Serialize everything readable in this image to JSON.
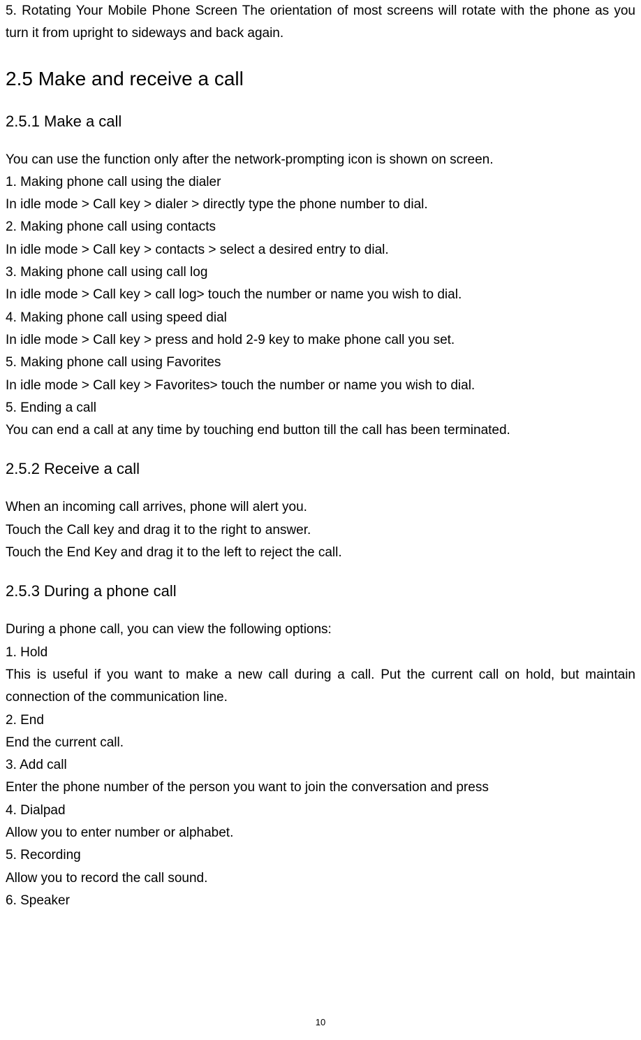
{
  "intro": {
    "text": "5. Rotating Your Mobile Phone Screen The orientation of most screens will rotate with the phone as you turn it from upright to sideways and back again."
  },
  "section": {
    "heading": "2.5 Make and receive a call",
    "sub1": {
      "heading": "2.5.1 Make a call",
      "lines": [
        "You can use the function only after the network-prompting icon is shown on screen.",
        "1. Making phone call using the dialer",
        "In idle mode > Call key > dialer > directly type the phone number to dial.",
        "2. Making phone call using contacts",
        "In idle mode > Call key > contacts > select a desired entry to dial.",
        "3. Making phone call using call log",
        "In idle mode > Call key > call log> touch the number or name you wish to dial.",
        "4. Making phone call using speed dial",
        "In idle mode > Call key > press and hold 2-9 key to make phone call you set.",
        "5. Making phone call using Favorites",
        "In idle mode > Call key > Favorites> touch the number or name you wish to dial.",
        "5. Ending a call",
        "You can end a call at any time by touching end button till the call has been terminated."
      ]
    },
    "sub2": {
      "heading": "2.5.2 Receive a call",
      "lines": [
        "When an incoming call arrives, phone will alert you.",
        "Touch the Call key and drag it to the right to answer.",
        "Touch the End Key and drag it to the left to reject the call."
      ]
    },
    "sub3": {
      "heading": "2.5.3 During a phone call",
      "lines": [
        "During a phone call, you can view the following options:",
        "1. Hold",
        "This is useful if you want to make a new call during a call. Put the current call on hold, but maintain connection of the communication line.",
        "2. End",
        "End the current call.",
        "3. Add call",
        "Enter the phone number of the person you want to join the conversation and press",
        "4. Dialpad",
        "Allow you to enter number or alphabet.",
        "5. Recording",
        "Allow you to record the call sound.",
        "6. Speaker"
      ]
    }
  },
  "pageNumber": "10"
}
